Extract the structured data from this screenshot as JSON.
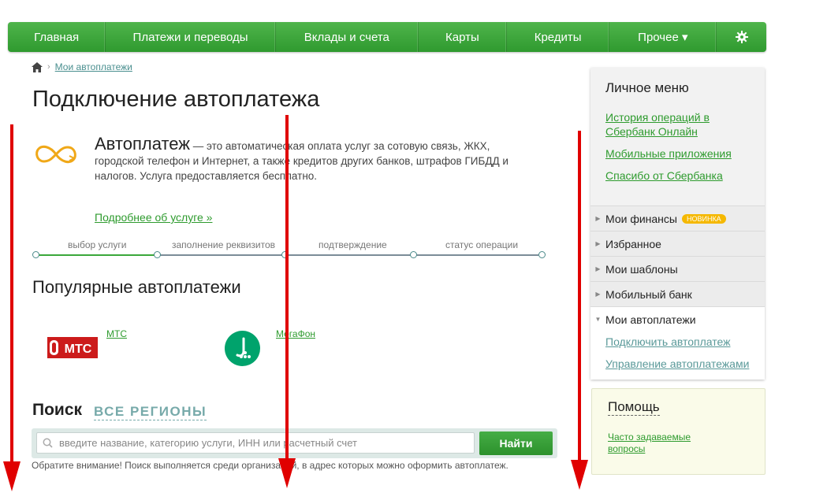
{
  "nav": {
    "items": [
      "Главная",
      "Платежи и переводы",
      "Вклады и счета",
      "Карты",
      "Кредиты",
      "Прочее ▾"
    ],
    "settings_icon": "gear-icon"
  },
  "breadcrumb": {
    "home_icon": "home-icon",
    "current": "Мои автоплатежи"
  },
  "page_title": "Подключение автоплатежа",
  "autopay": {
    "icon": "infinity-icon",
    "term": "Автоплатеж",
    "description": " — это автоматическая оплата услуг за сотовую связь, ЖКХ, городской телефон и Интернет, а также кредитов других банков, штрафов ГИБДД и налогов. Услуга предоставляется бесплатно.",
    "more_link": "Подробнее об услуге »"
  },
  "steps": {
    "labels": [
      "выбор услуги",
      "заполнение реквизитов",
      "подтверждение",
      "статус операции"
    ],
    "current_index": 0
  },
  "popular": {
    "title": "Популярные автоплатежи",
    "items": [
      {
        "name": "МТС",
        "logo_text": "МТС"
      },
      {
        "name": "МегаФон"
      }
    ]
  },
  "search": {
    "title": "Поиск",
    "regions": "ВСЕ РЕГИОНЫ",
    "placeholder": "введите название, категорию услуги, ИНН или расчетный счет",
    "button": "Найти",
    "note": "Обратите внимание! Поиск выполняется среди организаций, в адрес которых можно оформить автоплатеж."
  },
  "personal_menu": {
    "title": "Личное меню",
    "links": [
      "История операций в Сбербанк Онлайн",
      "Мобильные приложения",
      "Спасибо от Сбербанка"
    ],
    "rows": [
      "Мои финансы",
      "Избранное",
      "Мои шаблоны",
      "Мобильный банк",
      "Мои автоплатежи"
    ],
    "badge": "НОВИНКА",
    "sub_links": [
      "Подключить автоплатеж",
      "Управление автоплатежами"
    ]
  },
  "help": {
    "title": "Помощь",
    "link": "Часто задаваемые вопросы"
  },
  "colors": {
    "brand_green": "#3aa73a",
    "link_green": "#2e9b2e",
    "annotation_red": "#e00000"
  }
}
